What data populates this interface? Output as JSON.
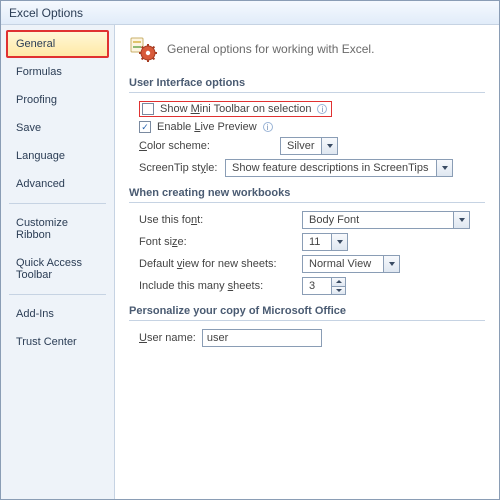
{
  "window": {
    "title": "Excel Options"
  },
  "sidebar": {
    "items": [
      {
        "label": "General",
        "selected": true,
        "highlight": true
      },
      {
        "label": "Formulas"
      },
      {
        "label": "Proofing"
      },
      {
        "label": "Save"
      },
      {
        "label": "Language"
      },
      {
        "label": "Advanced"
      },
      {
        "divider": true
      },
      {
        "label": "Customize Ribbon"
      },
      {
        "label": "Quick Access Toolbar"
      },
      {
        "divider": true
      },
      {
        "label": "Add-Ins"
      },
      {
        "label": "Trust Center"
      }
    ]
  },
  "content": {
    "header": "General options for working with Excel.",
    "sections": {
      "ui": {
        "title": "User Interface options",
        "show_mini_toolbar": {
          "label_pre": "Show ",
          "label_u": "M",
          "label_post": "ini Toolbar on selection",
          "checked": false,
          "highlight": true
        },
        "enable_live_preview": {
          "label_pre": "Enable ",
          "label_u": "L",
          "label_post": "ive Preview",
          "checked": true
        },
        "color_scheme": {
          "label_pre": "",
          "label_u": "C",
          "label_post": "olor scheme:",
          "value": "Silver"
        },
        "screentip": {
          "label_pre": "ScreenTip st",
          "label_u": "y",
          "label_post": "le:",
          "value": "Show feature descriptions in ScreenTips"
        }
      },
      "newwb": {
        "title": "When creating new workbooks",
        "use_font": {
          "label_pre": "Use this fo",
          "label_u": "n",
          "label_post": "t:",
          "value": "Body Font"
        },
        "font_size": {
          "label_pre": "Font si",
          "label_u": "z",
          "label_post": "e:",
          "value": "11"
        },
        "default_view": {
          "label_pre": "Default ",
          "label_u": "v",
          "label_post": "iew for new sheets:",
          "value": "Normal View"
        },
        "sheets": {
          "label_pre": "Include this many ",
          "label_u": "s",
          "label_post": "heets:",
          "value": "3"
        }
      },
      "personalize": {
        "title": "Personalize your copy of Microsoft Office",
        "user_name": {
          "label_u": "U",
          "label_post": "ser name:",
          "value": "user"
        }
      }
    }
  }
}
